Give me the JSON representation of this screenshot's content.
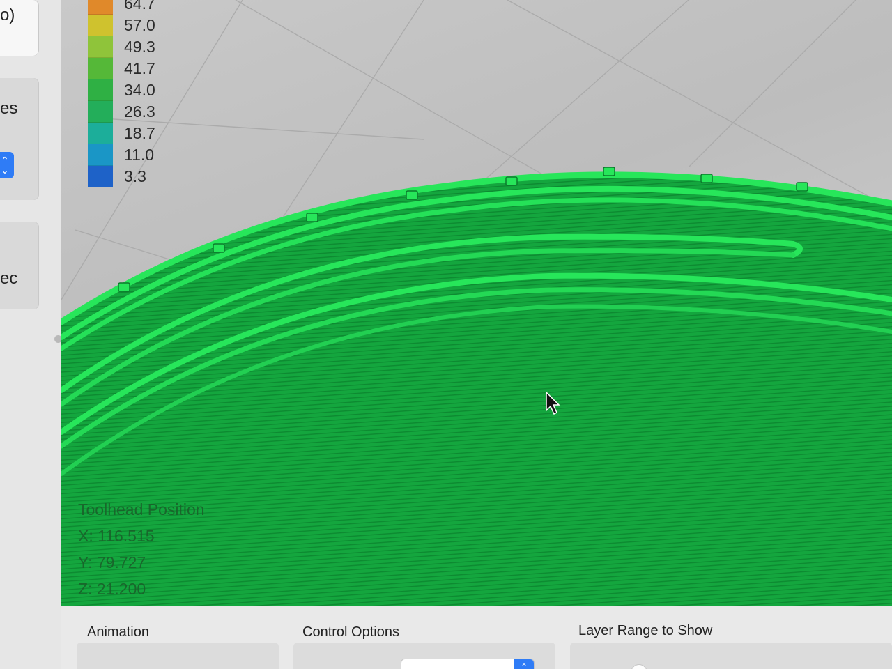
{
  "sidebar": {
    "fragments": {
      "top": "o)",
      "mid": "es",
      "low": "ec"
    }
  },
  "legend": {
    "entries": [
      {
        "value": "64.7",
        "color": "#e0892a"
      },
      {
        "value": "57.0",
        "color": "#cfc22e"
      },
      {
        "value": "49.3",
        "color": "#8fc43a"
      },
      {
        "value": "41.7",
        "color": "#55b838"
      },
      {
        "value": "34.0",
        "color": "#2fb044"
      },
      {
        "value": "26.3",
        "color": "#23ae5a"
      },
      {
        "value": "18.7",
        "color": "#1cae9a"
      },
      {
        "value": "11.0",
        "color": "#1a96c6"
      },
      {
        "value": "3.3",
        "color": "#1e62c8"
      }
    ]
  },
  "toolhead": {
    "title": "Toolhead Position",
    "x": "X: 116.515",
    "y": "Y: 79.727",
    "z": "Z: 21.200"
  },
  "panels": {
    "animation": "Animation",
    "control_options": "Control Options",
    "layer_range": "Layer Range to Show"
  },
  "colors": {
    "infill": "#12a43c",
    "perimeter": "#27e65a",
    "grid_background": "#c6c6c6",
    "accent": "#2f7cf6"
  },
  "icons": {
    "cursor": "mouse-pointer-icon",
    "stepper": "up-down-stepper-icon",
    "select_arrow": "chevron-up-down-icon"
  }
}
